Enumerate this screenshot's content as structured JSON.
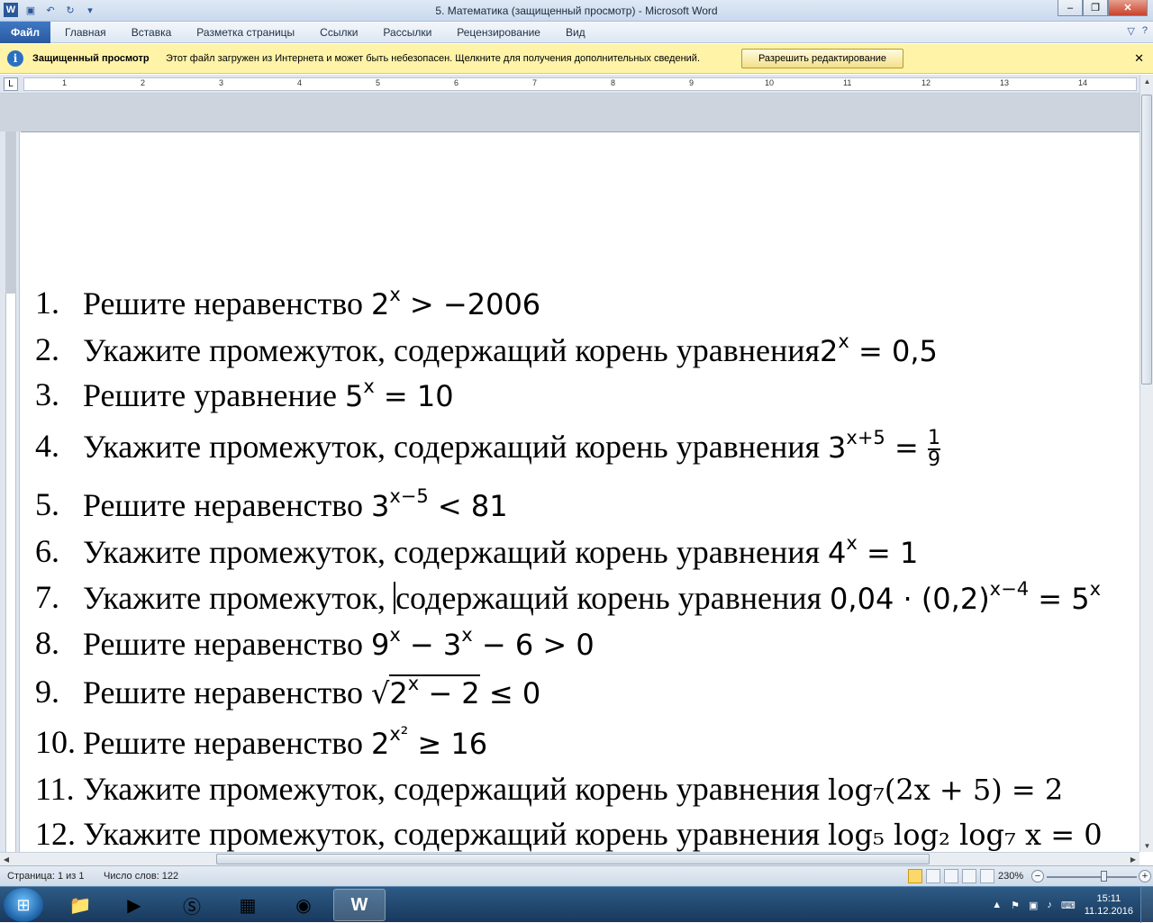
{
  "titlebar": {
    "title": "5. Математика (защищенный просмотр)  -  Microsoft Word",
    "save_icon": "save-icon",
    "undo_icon": "undo-icon",
    "redo_icon": "redo-icon"
  },
  "ribbon": {
    "file_tab": "Файл",
    "tabs": [
      "Главная",
      "Вставка",
      "Разметка страницы",
      "Ссылки",
      "Рассылки",
      "Рецензирование",
      "Вид"
    ]
  },
  "protected_bar": {
    "title": "Защищенный просмотр",
    "message": "Этот файл загружен из Интернета и может быть небезопасен. Щелкните для получения дополнительных сведений.",
    "button": "Разрешить редактирование",
    "close": "✕"
  },
  "ruler": {
    "ticks": [
      "1",
      "2",
      "3",
      "4",
      "5",
      "6",
      "7",
      "8",
      "9",
      "10",
      "11",
      "12",
      "13",
      "14"
    ],
    "tab_marker": "L"
  },
  "document": {
    "items": [
      {
        "num": "1.",
        "text": "Решите неравенство "
      },
      {
        "num": "2.",
        "text": "Укажите промежуток, содержащий корень уравнения"
      },
      {
        "num": "3.",
        "text": "Решите уравнение "
      },
      {
        "num": "4.",
        "text": "Укажите промежуток, содержащий корень уравнения "
      },
      {
        "num": "5.",
        "text": "Решите неравенство "
      },
      {
        "num": "6.",
        "text": "Укажите промежуток, содержащий корень уравнения "
      },
      {
        "num": "7.",
        "text_before_cursor": "Укажите промежуток, ",
        "text_after_cursor": "содержащий корень уравнения "
      },
      {
        "num": "8.",
        "text": "Решите неравенство "
      },
      {
        "num": "9.",
        "text": "Решите неравенство "
      },
      {
        "num": "10.",
        "text": "Решите неравенство "
      },
      {
        "num": "11.",
        "text": "Укажите промежуток, содержащий корень уравнения "
      },
      {
        "num": "12.",
        "text": "Укажите промежуток, содержащий корень уравнения "
      }
    ],
    "math": {
      "m1_base": "2",
      "m1_exp": "x",
      "m1_rest": " > −2006",
      "m2_base": "2",
      "m2_exp": "x",
      "m2_rest": " = 0,5",
      "m3_base": "5",
      "m3_exp": "x",
      "m3_rest": " = 10",
      "m4_base": "3",
      "m4_exp": "x+5",
      "m4_rest": " = ",
      "m4_num": "1",
      "m4_den": "9",
      "m5_base": "3",
      "m5_exp": "x−5",
      "m5_rest": " < 81",
      "m6_base": "4",
      "m6_exp": "x",
      "m6_rest": " = 1",
      "m7_a": "0,04 · (0,2)",
      "m7_exp": "x−4",
      "m7_b": " = 5",
      "m7_exp2": "x",
      "m8_a": "9",
      "m8_exp": "x",
      "m8_b": " − 3",
      "m8_exp2": "x",
      "m8_c": " − 6 > 0",
      "m9_root": "√",
      "m9_base": "2",
      "m9_exp": "x",
      "m9_rest": " − 2",
      "m9_tail": "  ≤ 0",
      "m10_base": "2",
      "m10_exp": "x²",
      "m10_rest": "  ≥ 16",
      "m11": "log₇(2x + 5) = 2",
      "m12": "log₅ log₂ log₇ x = 0"
    }
  },
  "statusbar": {
    "pages": "Страница: 1 из 1",
    "words": "Число слов: 122",
    "zoom": "230%",
    "zoom_minus": "−",
    "zoom_plus": "+",
    "zoom_level_percent": 230
  },
  "taskbar": {
    "time": "15:11",
    "date": "11.12.2016",
    "apps": [
      "explorer-icon",
      "media-player-icon",
      "skype-icon",
      "task-manager-icon",
      "chrome-icon",
      "word-icon"
    ]
  },
  "colors": {
    "file_tab": "#2a5aa0",
    "protected_bar": "#fff3a8",
    "taskbar": "#18395c"
  }
}
